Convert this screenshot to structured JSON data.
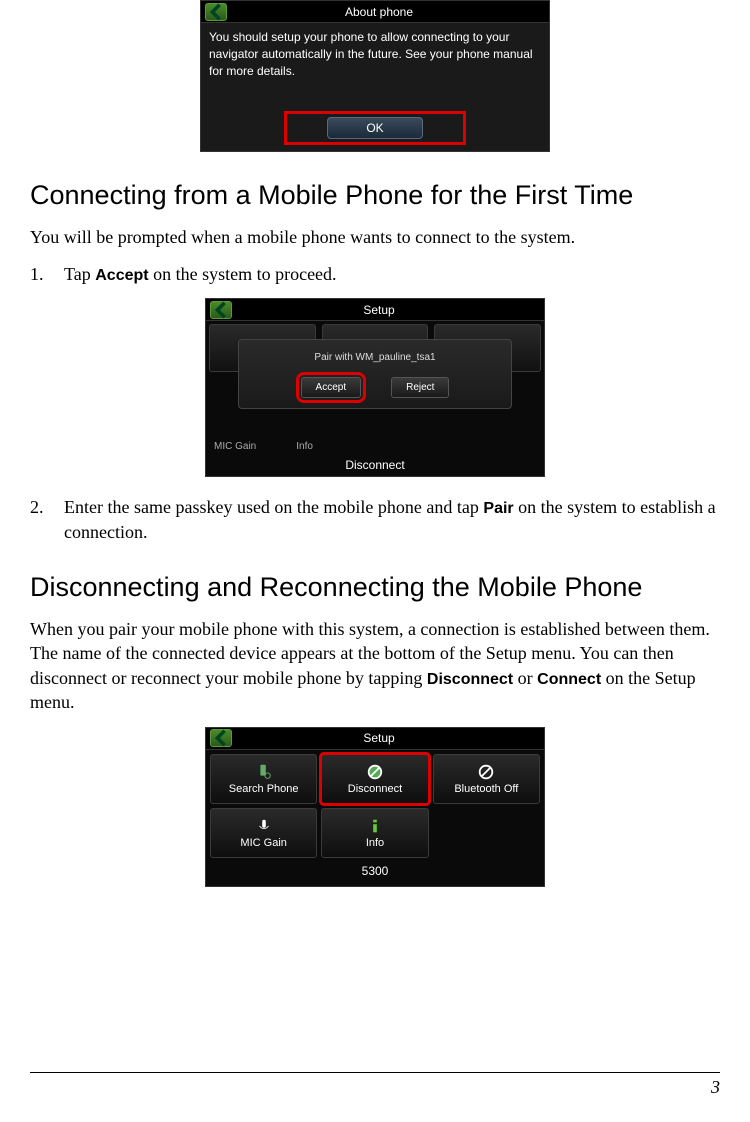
{
  "screen_about": {
    "title": "About phone",
    "body": "You should setup your phone to allow connecting to your navigator automatically in the future. See your phone manual for more details.",
    "ok_label": "OK"
  },
  "heading_connecting": "Connecting from a Mobile Phone for the First Time",
  "intro_connecting": "You will be prompted when a mobile phone wants to connect to the system.",
  "step1_prefix": "1.",
  "step1_a": "Tap ",
  "step1_accept": "Accept",
  "step1_b": " on the system to proceed.",
  "screen_setup_dialog": {
    "title": "Setup",
    "dialog_title": "Pair with WM_pauline_tsa1",
    "accept_label": "Accept",
    "reject_label": "Reject",
    "mic_label": "MIC Gain",
    "info_label": "Info",
    "disconnect_label": "Disconnect"
  },
  "step2_prefix": "2.",
  "step2_a": "Enter the same passkey used on the mobile phone and tap ",
  "step2_pair": "Pair",
  "step2_b": " on the system to establish a connection.",
  "heading_disconnect": "Disconnecting and Reconnecting the Mobile Phone",
  "para_disconnect_a": "When you pair your mobile phone with this system, a connection is established between them. The name of the connected device appears at the bottom of the Setup menu. You can then disconnect or reconnect your mobile phone by tapping ",
  "para_disconnect_bold1": "Disconnect",
  "para_disconnect_mid": " or ",
  "para_disconnect_bold2": "Connect",
  "para_disconnect_b": " on the Setup menu.",
  "screen_setup_grid": {
    "title": "Setup",
    "search_phone": "Search Phone",
    "disconnect": "Disconnect",
    "bluetooth_off": "Bluetooth Off",
    "mic_gain": "MIC Gain",
    "info": "Info",
    "device_name": "5300"
  },
  "page_number": "3"
}
